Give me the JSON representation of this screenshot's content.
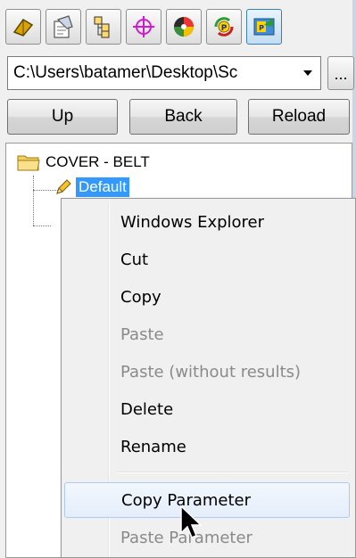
{
  "toolbar": {
    "buttons": [
      {
        "icon": "parts-icon",
        "active": false
      },
      {
        "icon": "properties-icon",
        "active": false
      },
      {
        "icon": "configuration-icon",
        "active": false
      },
      {
        "icon": "target-icon",
        "active": false
      },
      {
        "icon": "appearance-icon",
        "active": false
      },
      {
        "icon": "parameter-refresh-icon",
        "active": false
      },
      {
        "icon": "parameter-browser-icon",
        "active": true
      }
    ]
  },
  "path": {
    "value": "C:\\Users\\batamer\\Desktop\\Sc",
    "browse_label": "..."
  },
  "nav": {
    "up_label": "Up",
    "back_label": "Back",
    "reload_label": "Reload"
  },
  "tree": {
    "root_label": "COVER - BELT",
    "selected_child_label": "Default"
  },
  "context_menu": {
    "items": [
      {
        "label": "Windows Explorer",
        "enabled": true
      },
      {
        "label": "Cut",
        "enabled": true
      },
      {
        "label": "Copy",
        "enabled": true
      },
      {
        "label": "Paste",
        "enabled": false
      },
      {
        "label": "Paste (without results)",
        "enabled": false
      },
      {
        "label": "Delete",
        "enabled": true
      },
      {
        "label": "Rename",
        "enabled": true
      },
      {
        "label": "Copy Parameter",
        "enabled": true,
        "hovered": true
      },
      {
        "label": "Paste Parameter",
        "enabled": false
      }
    ]
  },
  "colors": {
    "selection": "#3399ff",
    "menu_hover": "#e4eefa",
    "disabled_text": "#8a8a8a",
    "window_accent": "#a9c7e8"
  }
}
